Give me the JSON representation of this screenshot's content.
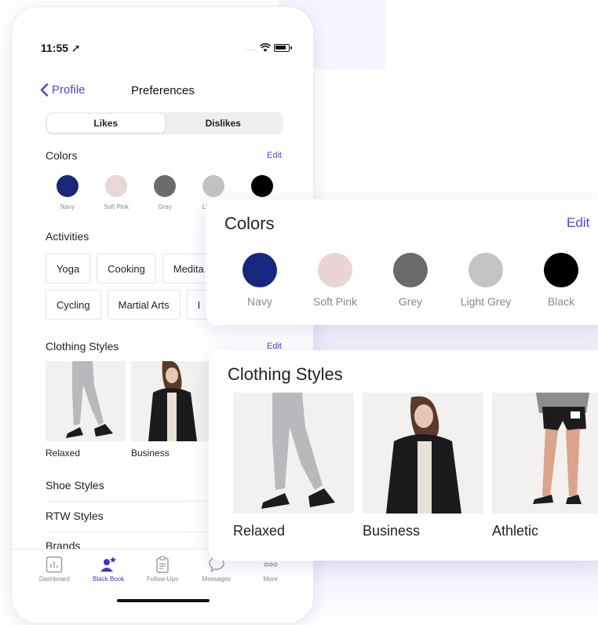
{
  "status": {
    "time": "11:55"
  },
  "nav": {
    "back_label": "Profile",
    "title": "Preferences"
  },
  "segments": {
    "likes": "Likes",
    "dislikes": "Dislikes"
  },
  "colors": {
    "label": "Colors",
    "edit": "Edit",
    "swatches": [
      {
        "name": "Navy",
        "hex": "#1a2676"
      },
      {
        "name": "Soft Pink",
        "hex": "#ead6d6"
      },
      {
        "name": "Grey",
        "hex": "#6b6b6b"
      },
      {
        "name": "Light Gr",
        "hex": "#c2c2c2"
      },
      {
        "name": "",
        "hex": "#000000"
      }
    ]
  },
  "activities": {
    "label": "Activities",
    "row1": [
      "Yoga",
      "Cooking",
      "Medita"
    ],
    "row2": [
      "Cycling",
      "Martial Arts",
      "I"
    ]
  },
  "clothing": {
    "label": "Clothing Styles",
    "edit": "Edit",
    "items": [
      "Relaxed",
      "Business"
    ]
  },
  "sections": [
    "Shoe Styles",
    "RTW Styles",
    "Brands"
  ],
  "tabs": [
    {
      "label": "Dashboard",
      "icon": "chart-icon"
    },
    {
      "label": "Black Book",
      "icon": "users-star-icon"
    },
    {
      "label": "Follow-Ups",
      "icon": "clipboard-icon"
    },
    {
      "label": "Messages",
      "icon": "chat-bubble-icon"
    },
    {
      "label": "More",
      "icon": "more-dots-icon"
    }
  ],
  "colors_card": {
    "title": "Colors",
    "edit": "Edit",
    "swatches": [
      {
        "name": "Navy",
        "hex": "#172780"
      },
      {
        "name": "Soft Pink",
        "hex": "#ead4d4"
      },
      {
        "name": "Grey",
        "hex": "#6a6a6a"
      },
      {
        "name": "Light Grey",
        "hex": "#c4c4c4"
      },
      {
        "name": "Black",
        "hex": "#000000"
      }
    ]
  },
  "styles_card": {
    "title": "Clothing Styles",
    "items": [
      "Relaxed",
      "Business",
      "Athletic"
    ]
  },
  "theme": {
    "accent": "#5b3fd8"
  }
}
